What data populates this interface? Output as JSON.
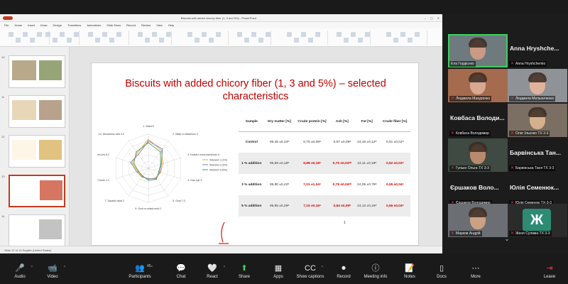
{
  "ppt": {
    "window_title": "Biscuits with added chicory fiber (1, 3 and 5%) - PowerPoint",
    "menu": [
      "File",
      "Home",
      "Insert",
      "Draw",
      "Design",
      "Transitions",
      "Animations",
      "Slide Show",
      "Record",
      "Review",
      "View",
      "Help"
    ],
    "status_text": "Slide 12 of 14   English (United States)",
    "thumb_numbers": [
      "10",
      "11",
      "12",
      "13",
      "14"
    ]
  },
  "slide": {
    "title": "Biscuits with added chicory fiber (1, 3 and 5%) – selected characteristics",
    "page_marker": "1"
  },
  "chart_data": {
    "type": "radar",
    "axes": [
      "1. Wład 5",
      "2. Wład ro-zkład/ość",
      "3. Kształ-t krwa-zwrotność",
      "4. Gaz-zyb 3",
      "5. Gust 2",
      "6. Gust ro-zkład-ność",
      "7. Zapach 1",
      "8. Chorle 2",
      "9. Chorle2 6",
      "10. Woodness 3"
    ],
    "axis_labels_display": [
      "1. Wład 5",
      "2. Wład ro-zkład/ość 3",
      "3. Kształ-t krwa-zwrotność 4",
      "4. Gaz zyb 3",
      "5. Gust 7.3",
      "6. Gust ro-zkład-ność 1",
      "7. Zapach-wład 2",
      "8. Chorle 2.2",
      "9. Chorle2 (web-zb) 8.2",
      "10. Woodness wild 3.2"
    ],
    "series": [
      {
        "name": "Wariant 1 (1%)",
        "color": "#f5a623",
        "values": [
          8.5,
          6.5,
          4.5,
          3.8,
          3.5,
          3.2,
          3.0,
          3.2,
          5.0,
          5.5
        ]
      },
      {
        "name": "Wariant 2 (3%)",
        "color": "#7d7ec9",
        "values": [
          8.0,
          7.0,
          4.0,
          3.5,
          3.8,
          3.0,
          3.2,
          3.5,
          5.5,
          5.0
        ]
      },
      {
        "name": "Wariant 3 (5%)",
        "color": "#4a9d5c",
        "values": [
          7.5,
          6.0,
          3.8,
          3.2,
          4.0,
          3.5,
          2.8,
          3.0,
          4.5,
          6.0
        ]
      }
    ],
    "rlim": [
      0,
      10
    ],
    "grid": true,
    "legend": "right"
  },
  "table": {
    "headers": [
      "Sample",
      "Dry matter [%]",
      "Crude protein [%]",
      "Ash [%]",
      "Fat [%]",
      "Crude fiber [%]"
    ],
    "rows": [
      {
        "sample": "Control",
        "cells": [
          "95,45 ±0,23ᵃ",
          "6,75 ±0,08ᵃ",
          "0,67 ±0,09ᵃ",
          "24,16 ±0,12ᵃ",
          "0,51 ±0,01ᵃ"
        ],
        "red": [
          false,
          false,
          false,
          false,
          false
        ]
      },
      {
        "sample": "1 % addition",
        "cells": [
          "95,69 ±0,18ᵃ",
          "6,88 ±0,18ᵃ",
          "0,75 ±0,04ᵃᵇ",
          "24,11 ±0,18ᵃ",
          "0,52 ±0,03ᵃ"
        ],
        "red": [
          false,
          true,
          true,
          false,
          true
        ]
      },
      {
        "sample": "3 % addition",
        "cells": [
          "95,80 ±0,42ᵃ",
          "7,01 ±1,04ᵃ",
          "0,78 ±0,04ᵃᵇ",
          "24,05 ±0,79ᵃ",
          "0,55 ±0,04ᵃ"
        ],
        "red": [
          false,
          true,
          true,
          false,
          true
        ]
      },
      {
        "sample": "5 % addition",
        "cells": [
          "95,85 ±0,29ᵃ",
          "7,15 ±0,16ᵃ",
          "0,84 ±0,05ᵇ",
          "24,12 ±0,16ᵃ",
          "0,56 ±0,04ᵃ"
        ],
        "red": [
          false,
          true,
          true,
          false,
          true
        ]
      }
    ]
  },
  "participants": [
    {
      "name": "Ела Гордієнко",
      "kind": "video",
      "face": "#c99a84",
      "bg": "#6e7a7d",
      "highlight": true
    },
    {
      "name": "Anna Hryshchenko",
      "kind": "name",
      "big": "Anna Hryshche..."
    },
    {
      "name": "Людмила Мазуренко",
      "kind": "video",
      "face": "#d8a890",
      "bg": "#a56b4e"
    },
    {
      "name": "Людмила Мельниченко",
      "kind": "video",
      "face": "#e0b29c",
      "bg": "#8f9397"
    },
    {
      "name": "Ковбаса Володимир",
      "kind": "name",
      "big": "Ковбаса Володи..."
    },
    {
      "name": "Олег Ільєнко ТХ 3-3",
      "kind": "video",
      "face": "#d6b08d",
      "bg": "#7a6f62"
    },
    {
      "name": "Гулько Ольга ТХ 3-3",
      "kind": "video",
      "face": "#b98b6e",
      "bg": "#3f4a42"
    },
    {
      "name": "Барвінська Таня ТХ 3-3",
      "kind": "name",
      "big": "Барвінська Тан..."
    },
    {
      "name": "Єршаков Володимир",
      "kind": "name",
      "big": "Єршаков Воло..."
    },
    {
      "name": "Юлія Семенюк ТХ-3-3",
      "kind": "name",
      "big": "Юлія Семенюк..."
    },
    {
      "name": "Марков Андрій",
      "kind": "video",
      "face": "#caa184",
      "bg": "#6b6e72"
    },
    {
      "name": "Женя Сулима ТХ 3-3",
      "kind": "letter",
      "letter": "Ж"
    }
  ],
  "toolbar": {
    "items": [
      {
        "label": "Audio",
        "icon": "🎤",
        "name": "audio"
      },
      {
        "label": "Video",
        "icon": "📹",
        "name": "video"
      },
      {
        "label": "Participants",
        "icon": "👥",
        "name": "participants",
        "count": "45"
      },
      {
        "label": "Chat",
        "icon": "💬",
        "name": "chat"
      },
      {
        "label": "React",
        "icon": "🤍",
        "name": "react"
      },
      {
        "label": "Share",
        "icon": "⬆",
        "name": "share"
      },
      {
        "label": "Apps",
        "icon": "▦",
        "name": "apps"
      },
      {
        "label": "Show captions",
        "icon": "CC",
        "name": "captions"
      },
      {
        "label": "Record",
        "icon": "⏺",
        "name": "record"
      },
      {
        "label": "Meeting info",
        "icon": "ⓘ",
        "name": "meeting-info"
      },
      {
        "label": "Notes",
        "icon": "📝",
        "name": "notes"
      },
      {
        "label": "Docs",
        "icon": "▯",
        "name": "docs"
      },
      {
        "label": "More",
        "icon": "⋯",
        "name": "more"
      },
      {
        "label": "Leave",
        "icon": "⇥",
        "name": "leave"
      }
    ]
  },
  "colors": {
    "title_red": "#c00000",
    "value_red": "#d60000",
    "active_speaker": "#3fcf5f",
    "leave_red": "#e04040"
  }
}
